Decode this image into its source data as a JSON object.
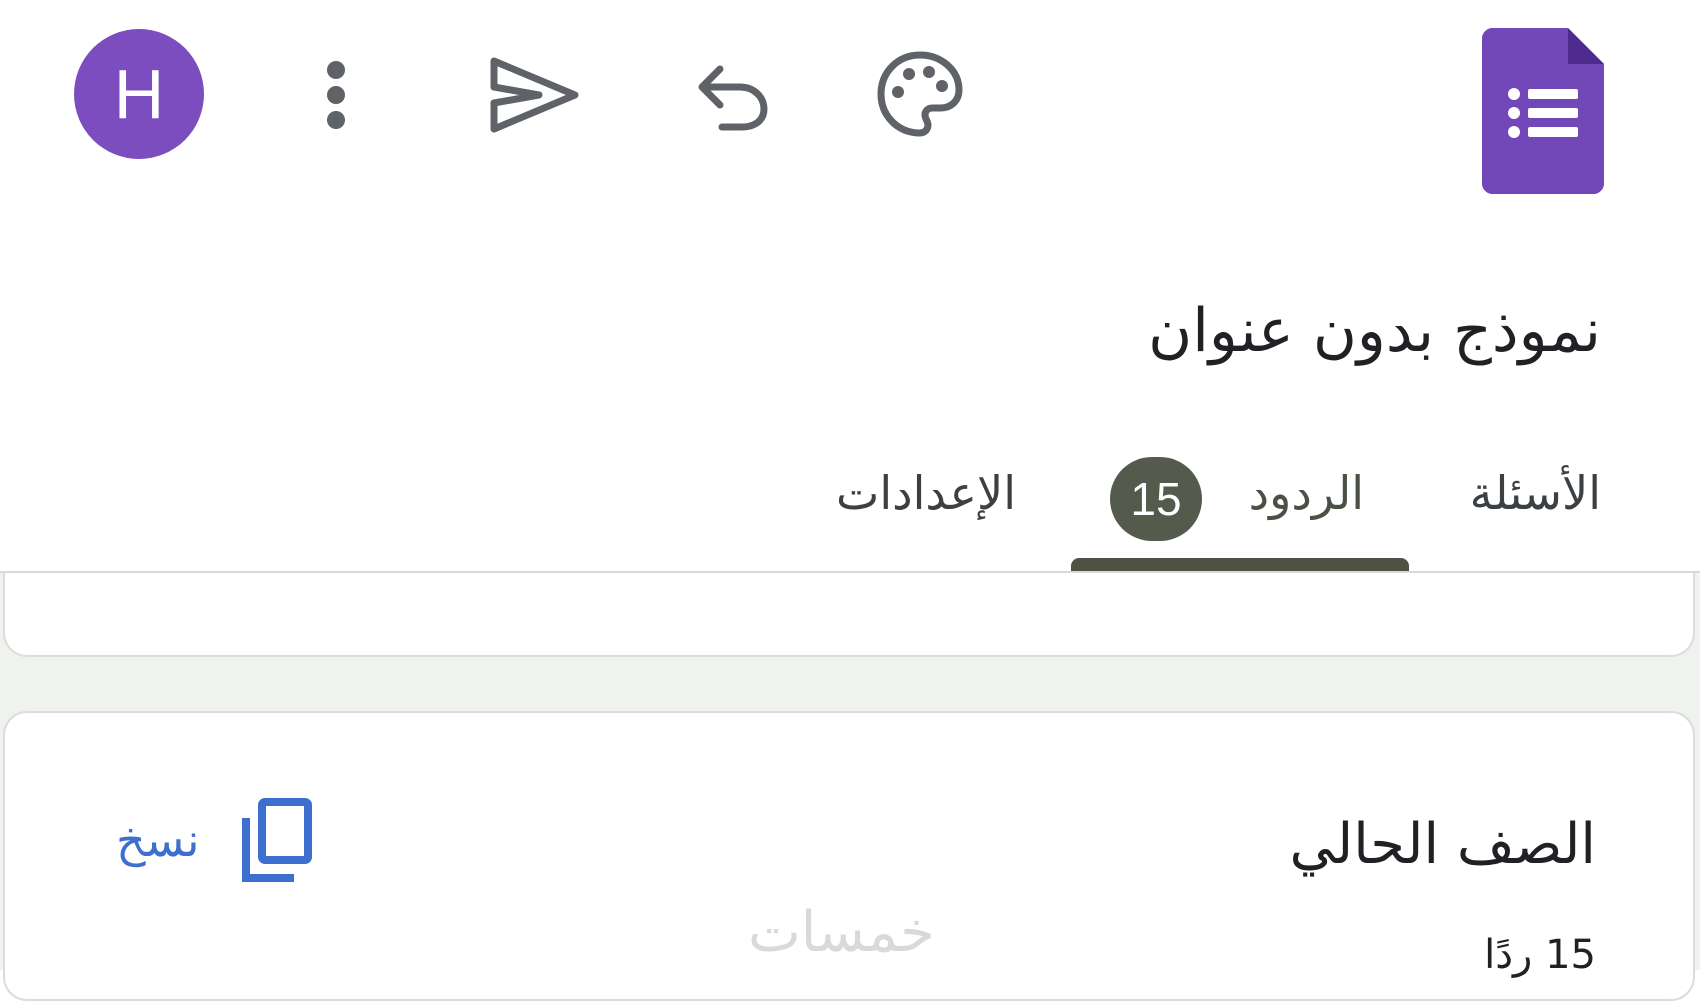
{
  "header": {
    "avatar_initial": "H",
    "avatar_color": "#7c4dbe",
    "icons": [
      "more-vert-icon",
      "send-icon",
      "undo-icon",
      "palette-icon",
      "google-forms-logo-icon"
    ],
    "accent_color": "#673ab7"
  },
  "form": {
    "title": "نموذج بدون عنوان"
  },
  "tabs": [
    {
      "label": "الأسئلة",
      "active": false
    },
    {
      "label": "الردود",
      "active": true,
      "badge": "15"
    },
    {
      "label": "الإعدادات",
      "active": false
    }
  ],
  "response_card": {
    "question_title": "الصف الحالي",
    "response_count": "15 ردًا",
    "copy_label": "نسخ",
    "copy_icon": "copy-icon",
    "link_color": "#3d6fce"
  },
  "watermark": "خمسات"
}
